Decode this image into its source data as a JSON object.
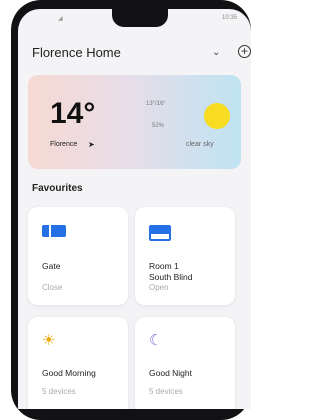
{
  "status_bar": {
    "time": "10:35"
  },
  "header": {
    "home_name": "Florence Home"
  },
  "weather": {
    "temperature": "14°",
    "city": "Florence",
    "temp_range": "13°/16°",
    "humidity": "52%",
    "condition": "clear sky"
  },
  "favourites": {
    "title": "Favourites",
    "items": [
      {
        "label": "Gate",
        "status": "Close",
        "icon": "gate-icon"
      },
      {
        "label": "Room 1\nSouth Blind",
        "status": "Open",
        "icon": "blind-icon"
      },
      {
        "label": "Good Morning",
        "status": "5 devices",
        "icon": "sunrise-icon"
      },
      {
        "label": "Good Night",
        "status": "5 devices",
        "icon": "moon-icon"
      }
    ]
  },
  "colors": {
    "accent_blue": "#2570e4",
    "sun_yellow": "#f7dc21",
    "moon_purple": "#7f6fd8",
    "sunrise_orange": "#f0a500"
  }
}
